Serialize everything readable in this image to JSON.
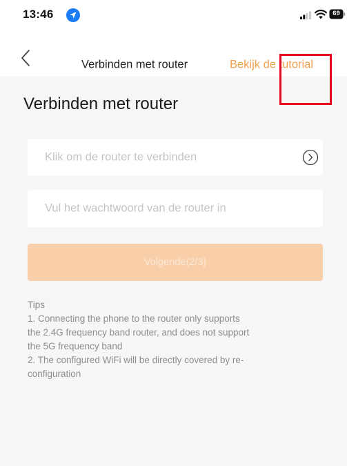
{
  "status_bar": {
    "time": "13:46",
    "battery": "69",
    "icons": [
      "location-icon",
      "signal-icon",
      "wifi-icon",
      "battery-icon"
    ]
  },
  "nav": {
    "back_icon": "chevron-left-icon",
    "title": "Verbinden met router",
    "tutorial_link": "Bekijk de tutorial"
  },
  "page": {
    "title": "Verbinden met router",
    "router_field": {
      "value": "Klik om de router te verbinden",
      "icon": "circle-chevron-right-icon"
    },
    "password_field": {
      "placeholder": "Vul het wachtwoord van de router in"
    },
    "next_button": "Volgende(2/3)"
  },
  "tips": {
    "heading": "Tips",
    "line1a": "1. Connecting the phone to the router only supports",
    "line1b": "the 2.4G frequency band router, and does not support",
    "line1c": "the 5G frequency band",
    "line2a": "2. The configured WiFi will be directly covered by re-",
    "line2b": "configuration"
  },
  "colors": {
    "accent": "#f0a050",
    "button_disabled": "#f9cfaa",
    "highlight": "#e3001b",
    "background": "#f6f6f6"
  }
}
